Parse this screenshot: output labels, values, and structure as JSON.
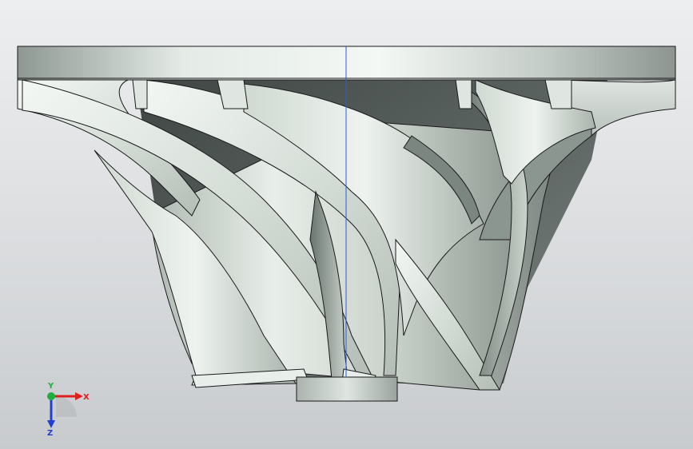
{
  "viewport": {
    "background_top": "#eceef0",
    "background_bottom": "#c8cbce"
  },
  "model": {
    "part": "impeller",
    "blade_count_visible": 9,
    "surface_color": "#c9d2cb",
    "shadow_color": "#5c6462",
    "edge_color": "#1a1a1a",
    "axis_line_color": "#2a5bd7"
  },
  "triad": {
    "x_label": "X",
    "y_label": "Y",
    "z_label": "Z",
    "x_color": "#e02020",
    "y_color": "#20b040",
    "z_color": "#2040d0"
  }
}
